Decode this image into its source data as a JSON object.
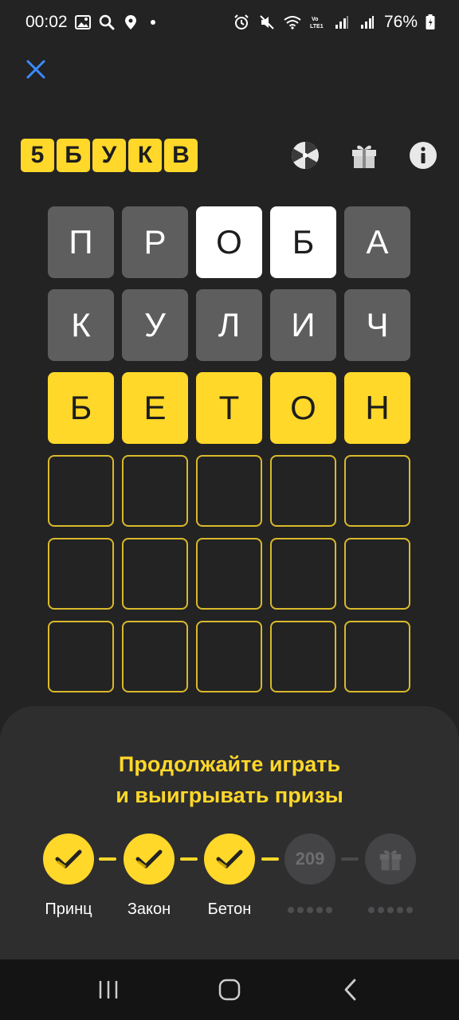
{
  "status": {
    "time": "00:02",
    "battery": "76%"
  },
  "header": {
    "logo_letters": [
      "5",
      "Б",
      "У",
      "К",
      "В"
    ],
    "icons": [
      "wheel-icon",
      "gift-icon",
      "info-icon"
    ]
  },
  "grid": {
    "rows": [
      [
        {
          "letter": "П",
          "state": "gray"
        },
        {
          "letter": "Р",
          "state": "gray"
        },
        {
          "letter": "О",
          "state": "white"
        },
        {
          "letter": "Б",
          "state": "white"
        },
        {
          "letter": "А",
          "state": "gray"
        }
      ],
      [
        {
          "letter": "К",
          "state": "gray"
        },
        {
          "letter": "У",
          "state": "gray"
        },
        {
          "letter": "Л",
          "state": "gray"
        },
        {
          "letter": "И",
          "state": "gray"
        },
        {
          "letter": "Ч",
          "state": "gray"
        }
      ],
      [
        {
          "letter": "Б",
          "state": "yellow"
        },
        {
          "letter": "Е",
          "state": "yellow"
        },
        {
          "letter": "Т",
          "state": "yellow"
        },
        {
          "letter": "О",
          "state": "yellow"
        },
        {
          "letter": "Н",
          "state": "yellow"
        }
      ],
      [
        {
          "letter": "",
          "state": "empty"
        },
        {
          "letter": "",
          "state": "empty"
        },
        {
          "letter": "",
          "state": "empty"
        },
        {
          "letter": "",
          "state": "empty"
        },
        {
          "letter": "",
          "state": "empty"
        }
      ],
      [
        {
          "letter": "",
          "state": "empty"
        },
        {
          "letter": "",
          "state": "empty"
        },
        {
          "letter": "",
          "state": "empty"
        },
        {
          "letter": "",
          "state": "empty"
        },
        {
          "letter": "",
          "state": "empty"
        }
      ],
      [
        {
          "letter": "",
          "state": "empty"
        },
        {
          "letter": "",
          "state": "empty"
        },
        {
          "letter": "",
          "state": "empty"
        },
        {
          "letter": "",
          "state": "empty"
        },
        {
          "letter": "",
          "state": "empty"
        }
      ]
    ]
  },
  "sheet": {
    "title_line1": "Продолжайте играть",
    "title_line2": "и выигрывать призы",
    "steps": [
      {
        "label": "Принц",
        "state": "done"
      },
      {
        "label": "Закон",
        "state": "done"
      },
      {
        "label": "Бетон",
        "state": "done"
      },
      {
        "label": "209",
        "state": "locked-number"
      },
      {
        "label": "",
        "state": "locked-gift"
      }
    ]
  },
  "colors": {
    "accent": "#ffd82a",
    "background": "#232324",
    "tile_gray": "#5e5e5f"
  }
}
